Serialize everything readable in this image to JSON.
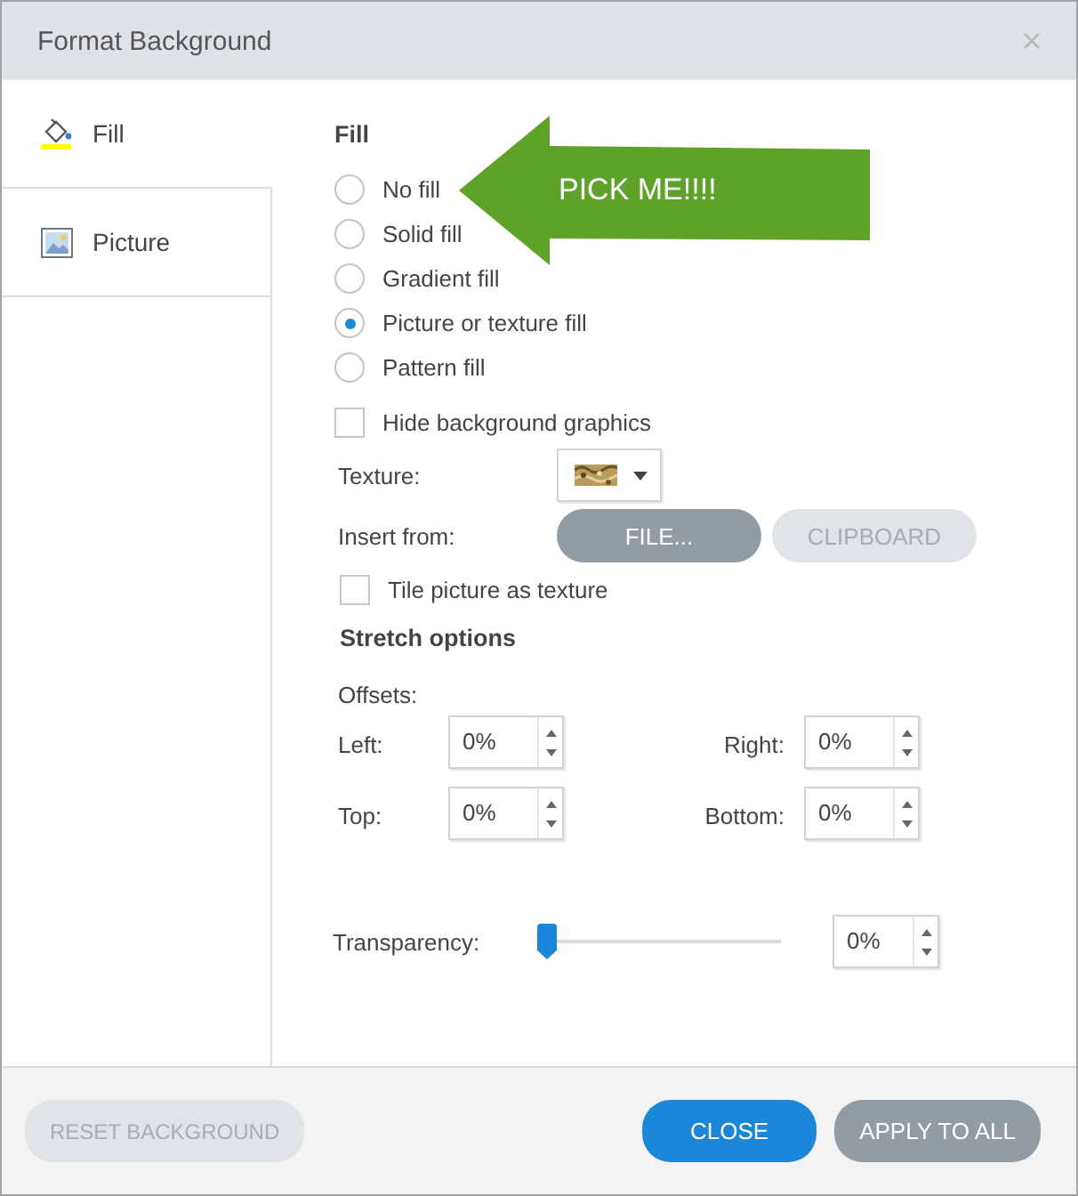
{
  "window": {
    "title": "Format Background"
  },
  "sidebar": {
    "tabs": [
      {
        "kind": "fill",
        "label": "Fill",
        "selected": true
      },
      {
        "kind": "picture",
        "label": "Picture",
        "selected": false
      }
    ]
  },
  "fill": {
    "heading": "Fill",
    "options": [
      {
        "label": "No fill",
        "selected": false
      },
      {
        "label": "Solid fill",
        "selected": false
      },
      {
        "label": "Gradient fill",
        "selected": false
      },
      {
        "label": "Picture or texture fill",
        "selected": true
      },
      {
        "label": "Pattern fill",
        "selected": false
      }
    ],
    "hide_background_graphics": {
      "label": "Hide background graphics",
      "checked": false
    },
    "texture": {
      "label": "Texture:"
    },
    "insert_from": {
      "label": "Insert from:",
      "buttons": [
        {
          "label": "FILE...",
          "disabled": false
        },
        {
          "label": "CLIPBOARD",
          "disabled": true
        }
      ]
    },
    "tile": {
      "label": "Tile picture as texture",
      "checked": false
    },
    "stretch_options": {
      "heading": "Stretch options",
      "offsets_label": "Offsets:",
      "offsets": [
        {
          "label": "Left:",
          "value": "0%"
        },
        {
          "label": "Right:",
          "value": "0%"
        },
        {
          "label": "Top:",
          "value": "0%"
        },
        {
          "label": "Bottom:",
          "value": "0%"
        }
      ]
    },
    "transparency": {
      "label": "Transparency:",
      "level": 0,
      "value": "0%"
    }
  },
  "callout": {
    "text": "PICK ME!!!!"
  },
  "footer": {
    "buttons": [
      {
        "kind": "secondary",
        "label": "RESET BACKGROUND",
        "disabled": true
      },
      {
        "kind": "primary",
        "label": "CLOSE",
        "disabled": false
      },
      {
        "kind": "secondary",
        "label": "APPLY TO ALL",
        "disabled": false
      }
    ]
  }
}
